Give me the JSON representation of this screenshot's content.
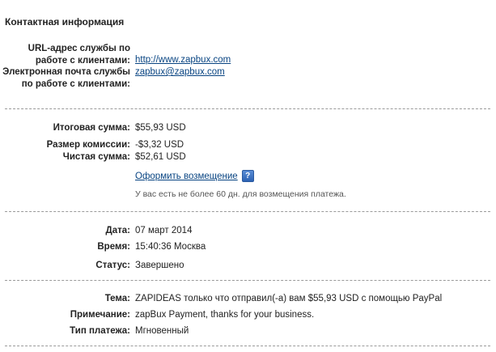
{
  "contact": {
    "title": "Контактная информация",
    "url_label": "URL-адрес службы по работе с клиентами:",
    "url_value": "http://www.zapbux.com",
    "email_label": "Электронная почта службы по работе с клиентами:",
    "email_value": "zapbux@zapbux.com"
  },
  "amounts": {
    "total_label": "Итоговая сумма:",
    "total_value": "$55,93 USD",
    "fee_label": "Размер комиссии:",
    "fee_value": "-$3,32 USD",
    "net_label": "Чистая сумма:",
    "net_value": "$52,61 USD",
    "refund_link": "Оформить возмещение",
    "help_icon": "question-mark-icon",
    "refund_note": "У вас есть не более 60 дн. для возмещения платежа."
  },
  "details": {
    "date_label": "Дата:",
    "date_value": "07 март 2014",
    "time_label": "Время:",
    "time_value": "15:40:36 Москва",
    "status_label": "Статус:",
    "status_value": "Завершено"
  },
  "message": {
    "subject_label": "Тема:",
    "subject_value": "ZAPIDEAS только что отправил(-а) вам $55,93 USD с помощью PayPal",
    "note_label": "Примечание:",
    "note_value": "zapBux Payment, thanks for your business.",
    "type_label": "Тип платежа:",
    "type_value": "Мгновенный"
  },
  "colors": {
    "link": "#084482",
    "help_icon": "#2c62b3",
    "separator": "#9a9a9a"
  }
}
